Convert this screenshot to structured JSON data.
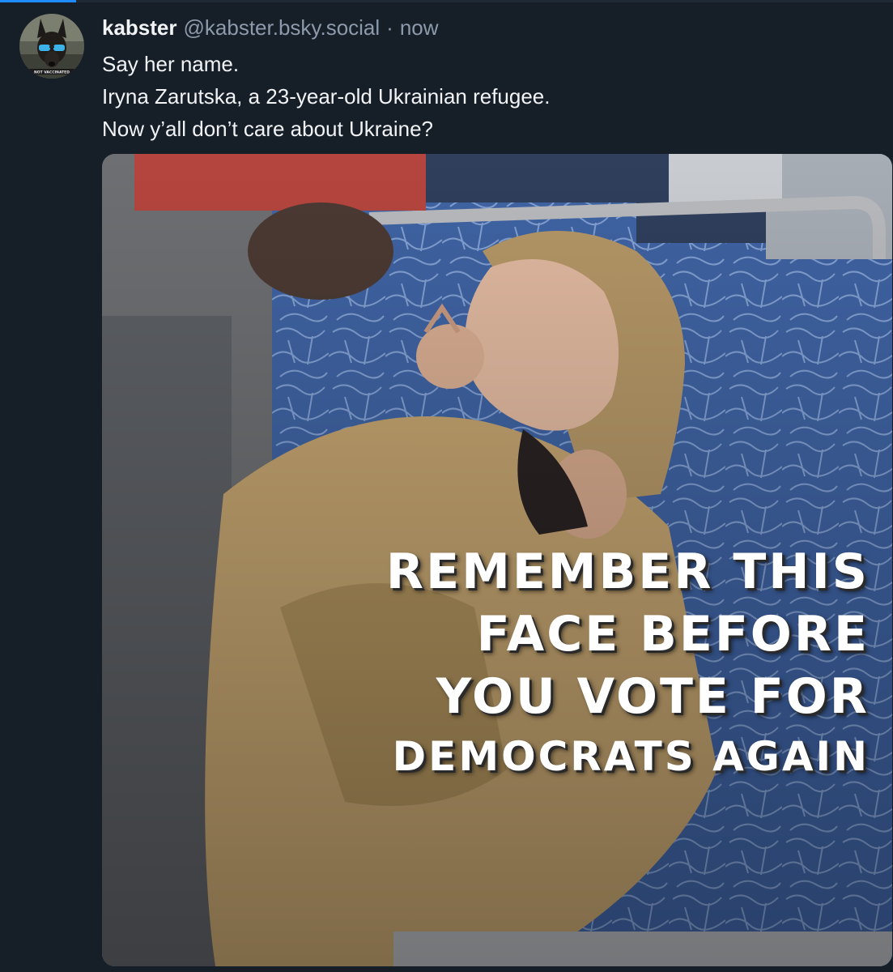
{
  "post": {
    "author": {
      "display_name": "kabster",
      "handle": "@kabster.bsky.social",
      "avatar_text": "NOT VACCINATED"
    },
    "separator": "·",
    "timestamp": "now",
    "text_lines": [
      "Say her name.",
      "Iryna Zarutska, a 23-year-old Ukrainian refugee.",
      "Now y’all don’t care about Ukraine?"
    ],
    "image": {
      "caption_lines": [
        "REMEMBER THIS",
        "FACE BEFORE",
        "YOU VOTE FOR",
        "DEMOCRATS AGAIN"
      ]
    }
  },
  "colors": {
    "background": "#161e27",
    "accent": "#208bfe",
    "text_primary": "#f1f3f5",
    "text_secondary": "#8c9aac"
  },
  "icons": {
    "avatar": "doberman-sunglasses-avatar"
  }
}
